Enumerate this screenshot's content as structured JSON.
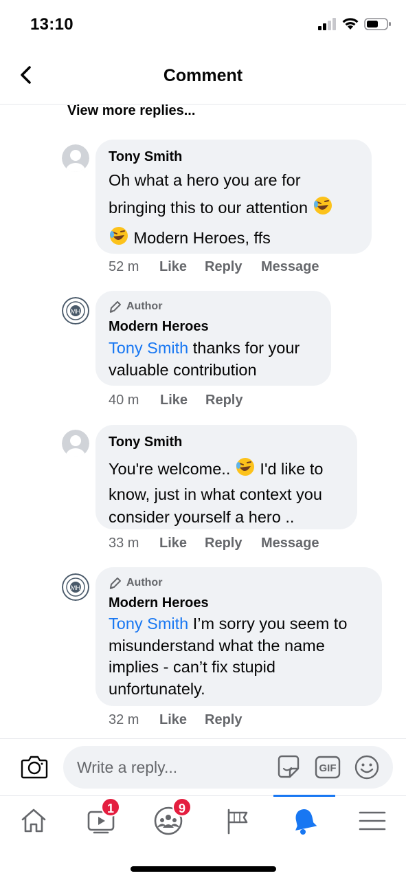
{
  "status": {
    "time": "13:10"
  },
  "header": {
    "title": "Comment"
  },
  "thread": {
    "more_label": "View more replies..."
  },
  "comments": [
    {
      "name": "Tony Smith",
      "lines": [
        "Oh what a hero you are for",
        "bringing this to our attention",
        "Modern Heroes, ffs"
      ],
      "time": "52 m",
      "like": "Like",
      "reply": "Reply",
      "message": "Message"
    },
    {
      "author_badge": "Author",
      "name": "Modern Heroes",
      "mention": "Tony Smith",
      "text_l1": " thanks for your",
      "text_l2": "valuable contribution",
      "time": "40 m",
      "like": "Like",
      "reply": "Reply"
    },
    {
      "name": "Tony Smith",
      "l1a": "You're welcome..",
      "l1b": "I'd like to",
      "l2": "know, just in what context you",
      "l3": "consider yourself a hero ..",
      "time": "33 m",
      "like": "Like",
      "reply": "Reply",
      "message": "Message"
    },
    {
      "author_badge": "Author",
      "name": "Modern Heroes",
      "mention": "Tony Smith",
      "text_l1": " I’m sorry you seem to",
      "text_l2": "misunderstand what the name",
      "text_l3": "implies - can’t fix stupid",
      "text_l4": "unfortunately.",
      "time": "32 m",
      "like": "Like",
      "reply": "Reply"
    }
  ],
  "composer": {
    "placeholder": "Write a reply..."
  },
  "tabs": {
    "video_badge": "1",
    "groups_badge": "9",
    "accent": "#1877f2",
    "badge_color": "#e41e3f"
  }
}
